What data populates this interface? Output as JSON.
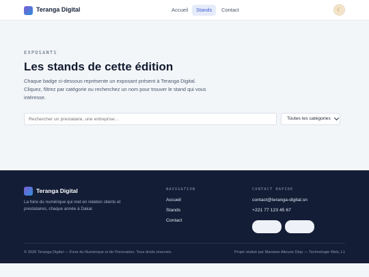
{
  "header": {
    "brand": "Teranga Digital",
    "nav": [
      "Accueil",
      "Stands",
      "Contact"
    ],
    "active_nav": "Stands",
    "theme_icon": "moon-icon"
  },
  "hero": {
    "eyebrow": "EXPOSANTS",
    "title": "Les stands de cette édition",
    "intro": "Chaque badge ci-dessous représente un exposant présent à Teranga Digital. Cliquez, filtrez par catégorie ou recherchez un nom pour trouver le stand qui vous intéresse."
  },
  "filters": {
    "search_placeholder": "Rechercher un prestataire, une entreprise...",
    "category_selected": "Toutes les catégories"
  },
  "footer": {
    "brand": "Teranga Digital",
    "description": "La foire du numérique qui met en relation clients et prestataires, chaque année à Dakar.",
    "nav_heading": "NAVIGATION",
    "nav_links": [
      "Accueil",
      "Stands",
      "Contact"
    ],
    "contact_heading": "CONTACT RAPIDE",
    "email": "contact@teranga-digital.sn",
    "phone": "+221 77 123 45 67",
    "copyright": "© 2026 Teranga Digital — Foire du Numérique et de l'Innovation. Tous droits réservés.",
    "credit": "Projet réalisé par Mariame Alioune Diop — Technologie Web, L1"
  },
  "colors": {
    "accent": "#3f5bd5",
    "footer_bg": "#131d36",
    "page_bg": "#f3f6f9"
  }
}
